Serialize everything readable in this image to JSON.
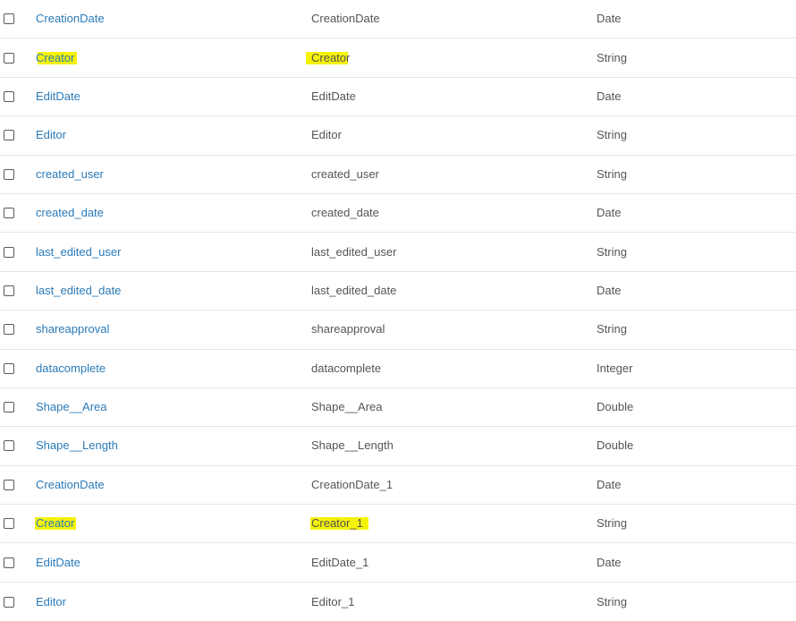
{
  "rows": [
    {
      "name": "CreationDate",
      "alias": "CreationDate",
      "type": "Date"
    },
    {
      "name": "Creator",
      "alias": "Creator",
      "type": "String"
    },
    {
      "name": "EditDate",
      "alias": "EditDate",
      "type": "Date"
    },
    {
      "name": "Editor",
      "alias": "Editor",
      "type": "String"
    },
    {
      "name": "created_user",
      "alias": "created_user",
      "type": "String"
    },
    {
      "name": "created_date",
      "alias": "created_date",
      "type": "Date"
    },
    {
      "name": "last_edited_user",
      "alias": "last_edited_user",
      "type": "String"
    },
    {
      "name": "last_edited_date",
      "alias": "last_edited_date",
      "type": "Date"
    },
    {
      "name": "shareapproval",
      "alias": "shareapproval",
      "type": "String"
    },
    {
      "name": "datacomplete",
      "alias": "datacomplete",
      "type": "Integer"
    },
    {
      "name": "Shape__Area",
      "alias": "Shape__Area",
      "type": "Double"
    },
    {
      "name": "Shape__Length",
      "alias": "Shape__Length",
      "type": "Double"
    },
    {
      "name": "CreationDate",
      "alias": "CreationDate_1",
      "type": "Date"
    },
    {
      "name": "Creator",
      "alias": "Creator_1",
      "type": "String"
    },
    {
      "name": "EditDate",
      "alias": "EditDate_1",
      "type": "Date"
    },
    {
      "name": "Editor",
      "alias": "Editor_1",
      "type": "String"
    }
  ],
  "highlight_color": "#f5f20a",
  "link_color": "#2a7ab8"
}
